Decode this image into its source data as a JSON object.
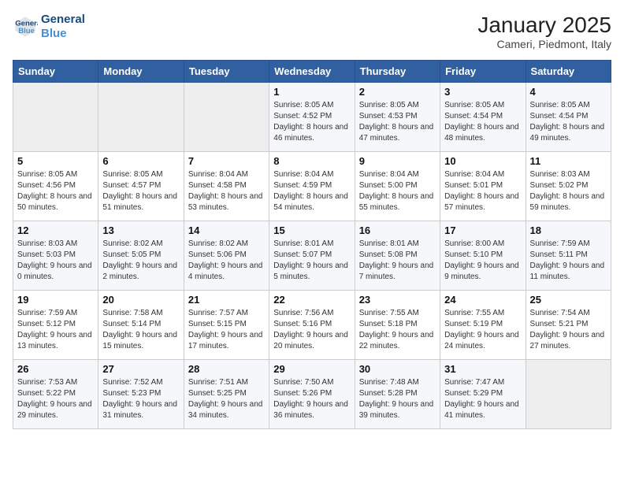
{
  "header": {
    "logo_line1": "General",
    "logo_line2": "Blue",
    "month_year": "January 2025",
    "location": "Cameri, Piedmont, Italy"
  },
  "weekdays": [
    "Sunday",
    "Monday",
    "Tuesday",
    "Wednesday",
    "Thursday",
    "Friday",
    "Saturday"
  ],
  "weeks": [
    [
      {
        "day": "",
        "sunrise": "",
        "sunset": "",
        "daylight": ""
      },
      {
        "day": "",
        "sunrise": "",
        "sunset": "",
        "daylight": ""
      },
      {
        "day": "",
        "sunrise": "",
        "sunset": "",
        "daylight": ""
      },
      {
        "day": "1",
        "sunrise": "Sunrise: 8:05 AM",
        "sunset": "Sunset: 4:52 PM",
        "daylight": "Daylight: 8 hours and 46 minutes."
      },
      {
        "day": "2",
        "sunrise": "Sunrise: 8:05 AM",
        "sunset": "Sunset: 4:53 PM",
        "daylight": "Daylight: 8 hours and 47 minutes."
      },
      {
        "day": "3",
        "sunrise": "Sunrise: 8:05 AM",
        "sunset": "Sunset: 4:54 PM",
        "daylight": "Daylight: 8 hours and 48 minutes."
      },
      {
        "day": "4",
        "sunrise": "Sunrise: 8:05 AM",
        "sunset": "Sunset: 4:54 PM",
        "daylight": "Daylight: 8 hours and 49 minutes."
      }
    ],
    [
      {
        "day": "5",
        "sunrise": "Sunrise: 8:05 AM",
        "sunset": "Sunset: 4:56 PM",
        "daylight": "Daylight: 8 hours and 50 minutes."
      },
      {
        "day": "6",
        "sunrise": "Sunrise: 8:05 AM",
        "sunset": "Sunset: 4:57 PM",
        "daylight": "Daylight: 8 hours and 51 minutes."
      },
      {
        "day": "7",
        "sunrise": "Sunrise: 8:04 AM",
        "sunset": "Sunset: 4:58 PM",
        "daylight": "Daylight: 8 hours and 53 minutes."
      },
      {
        "day": "8",
        "sunrise": "Sunrise: 8:04 AM",
        "sunset": "Sunset: 4:59 PM",
        "daylight": "Daylight: 8 hours and 54 minutes."
      },
      {
        "day": "9",
        "sunrise": "Sunrise: 8:04 AM",
        "sunset": "Sunset: 5:00 PM",
        "daylight": "Daylight: 8 hours and 55 minutes."
      },
      {
        "day": "10",
        "sunrise": "Sunrise: 8:04 AM",
        "sunset": "Sunset: 5:01 PM",
        "daylight": "Daylight: 8 hours and 57 minutes."
      },
      {
        "day": "11",
        "sunrise": "Sunrise: 8:03 AM",
        "sunset": "Sunset: 5:02 PM",
        "daylight": "Daylight: 8 hours and 59 minutes."
      }
    ],
    [
      {
        "day": "12",
        "sunrise": "Sunrise: 8:03 AM",
        "sunset": "Sunset: 5:03 PM",
        "daylight": "Daylight: 9 hours and 0 minutes."
      },
      {
        "day": "13",
        "sunrise": "Sunrise: 8:02 AM",
        "sunset": "Sunset: 5:05 PM",
        "daylight": "Daylight: 9 hours and 2 minutes."
      },
      {
        "day": "14",
        "sunrise": "Sunrise: 8:02 AM",
        "sunset": "Sunset: 5:06 PM",
        "daylight": "Daylight: 9 hours and 4 minutes."
      },
      {
        "day": "15",
        "sunrise": "Sunrise: 8:01 AM",
        "sunset": "Sunset: 5:07 PM",
        "daylight": "Daylight: 9 hours and 5 minutes."
      },
      {
        "day": "16",
        "sunrise": "Sunrise: 8:01 AM",
        "sunset": "Sunset: 5:08 PM",
        "daylight": "Daylight: 9 hours and 7 minutes."
      },
      {
        "day": "17",
        "sunrise": "Sunrise: 8:00 AM",
        "sunset": "Sunset: 5:10 PM",
        "daylight": "Daylight: 9 hours and 9 minutes."
      },
      {
        "day": "18",
        "sunrise": "Sunrise: 7:59 AM",
        "sunset": "Sunset: 5:11 PM",
        "daylight": "Daylight: 9 hours and 11 minutes."
      }
    ],
    [
      {
        "day": "19",
        "sunrise": "Sunrise: 7:59 AM",
        "sunset": "Sunset: 5:12 PM",
        "daylight": "Daylight: 9 hours and 13 minutes."
      },
      {
        "day": "20",
        "sunrise": "Sunrise: 7:58 AM",
        "sunset": "Sunset: 5:14 PM",
        "daylight": "Daylight: 9 hours and 15 minutes."
      },
      {
        "day": "21",
        "sunrise": "Sunrise: 7:57 AM",
        "sunset": "Sunset: 5:15 PM",
        "daylight": "Daylight: 9 hours and 17 minutes."
      },
      {
        "day": "22",
        "sunrise": "Sunrise: 7:56 AM",
        "sunset": "Sunset: 5:16 PM",
        "daylight": "Daylight: 9 hours and 20 minutes."
      },
      {
        "day": "23",
        "sunrise": "Sunrise: 7:55 AM",
        "sunset": "Sunset: 5:18 PM",
        "daylight": "Daylight: 9 hours and 22 minutes."
      },
      {
        "day": "24",
        "sunrise": "Sunrise: 7:55 AM",
        "sunset": "Sunset: 5:19 PM",
        "daylight": "Daylight: 9 hours and 24 minutes."
      },
      {
        "day": "25",
        "sunrise": "Sunrise: 7:54 AM",
        "sunset": "Sunset: 5:21 PM",
        "daylight": "Daylight: 9 hours and 27 minutes."
      }
    ],
    [
      {
        "day": "26",
        "sunrise": "Sunrise: 7:53 AM",
        "sunset": "Sunset: 5:22 PM",
        "daylight": "Daylight: 9 hours and 29 minutes."
      },
      {
        "day": "27",
        "sunrise": "Sunrise: 7:52 AM",
        "sunset": "Sunset: 5:23 PM",
        "daylight": "Daylight: 9 hours and 31 minutes."
      },
      {
        "day": "28",
        "sunrise": "Sunrise: 7:51 AM",
        "sunset": "Sunset: 5:25 PM",
        "daylight": "Daylight: 9 hours and 34 minutes."
      },
      {
        "day": "29",
        "sunrise": "Sunrise: 7:50 AM",
        "sunset": "Sunset: 5:26 PM",
        "daylight": "Daylight: 9 hours and 36 minutes."
      },
      {
        "day": "30",
        "sunrise": "Sunrise: 7:48 AM",
        "sunset": "Sunset: 5:28 PM",
        "daylight": "Daylight: 9 hours and 39 minutes."
      },
      {
        "day": "31",
        "sunrise": "Sunrise: 7:47 AM",
        "sunset": "Sunset: 5:29 PM",
        "daylight": "Daylight: 9 hours and 41 minutes."
      },
      {
        "day": "",
        "sunrise": "",
        "sunset": "",
        "daylight": ""
      }
    ]
  ]
}
